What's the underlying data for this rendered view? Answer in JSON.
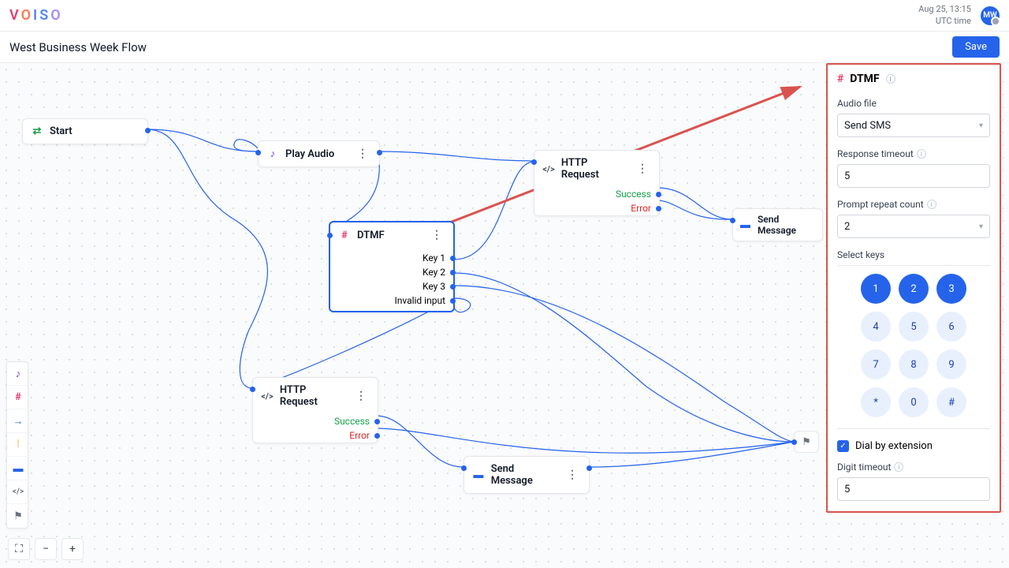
{
  "header": {
    "logo_letters": [
      "V",
      "O",
      "I",
      "S",
      "O"
    ],
    "date_line": "Aug 25, 13:15",
    "tz_line": "UTC time",
    "avatar_initials": "MW"
  },
  "subheader": {
    "title": "West Business Week Flow",
    "save_label": "Save"
  },
  "nodes": {
    "start": {
      "label": "Start"
    },
    "play_audio": {
      "label": "Play Audio"
    },
    "http1": {
      "label": "HTTP Request",
      "success": "Success",
      "error": "Error"
    },
    "dtmf": {
      "label": "DTMF",
      "k1": "Key 1",
      "k2": "Key 2",
      "k3": "Key 3",
      "invalid": "Invalid input"
    },
    "send_msg_top": {
      "label": "Send Message"
    },
    "http2": {
      "label": "HTTP Request",
      "success": "Success",
      "error": "Error"
    },
    "send_msg_bottom": {
      "label": "Send Message"
    }
  },
  "panel": {
    "title": "DTMF",
    "audio_label": "Audio file",
    "audio_value": "Send SMS",
    "resp_timeout_label": "Response timeout",
    "resp_timeout_value": "5",
    "repeat_label": "Prompt repeat count",
    "repeat_value": "2",
    "select_keys_label": "Select keys",
    "keys": [
      "1",
      "2",
      "3",
      "4",
      "5",
      "6",
      "7",
      "8",
      "9",
      "*",
      "0",
      "#"
    ],
    "active_keys": [
      "1",
      "2",
      "3"
    ],
    "dial_ext_label": "Dial by extension",
    "digit_timeout_label": "Digit timeout",
    "digit_timeout_value": "5"
  }
}
